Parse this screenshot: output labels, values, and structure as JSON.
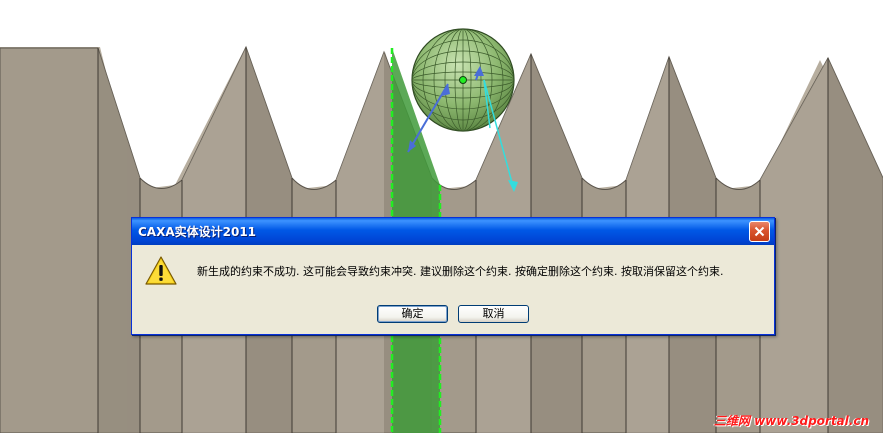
{
  "dialog": {
    "title": "CAXA实体设计2011",
    "message": "新生成的约束不成功. 这可能会导致约束冲突. 建议删除这个约束. 按确定删除这个约束. 按取消保留这个约束.",
    "ok_label": "确定",
    "cancel_label": "取消",
    "icon": "warning-icon",
    "close_icon": "close-icon"
  },
  "viewport": {
    "model_color": "#a39a8b",
    "highlight_face_color": "#3f9a3a",
    "highlight_edge_color": "#22ee22",
    "gizmo_color": "#8db870",
    "arrow_colors": [
      "#4a6ed8",
      "#33dddd"
    ]
  },
  "watermark": "三维网 www.3dportal.cn",
  "colors": {
    "titlebar": "#0058e6",
    "dialog_bg": "#ece9d8",
    "watermark": "#ff1a1a"
  }
}
